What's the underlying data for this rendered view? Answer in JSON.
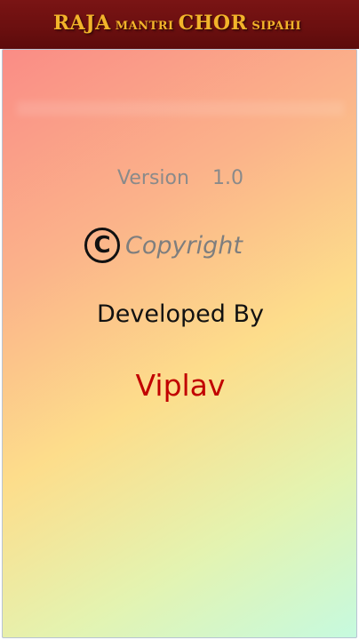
{
  "app": {
    "title_parts": [
      "RAJA",
      "MANTRI",
      "CHOR",
      "SIPAHI"
    ]
  },
  "about": {
    "version_label": "Version",
    "version_number": "1.0",
    "copyright_symbol": "C",
    "copyright_label": "Copyright",
    "developed_by_label": "Developed By",
    "developer_name": "Viplav"
  },
  "colors": {
    "title_bar": "#6a0f0f",
    "title_text": "#f2b42a",
    "developer_name": "#c10000"
  }
}
